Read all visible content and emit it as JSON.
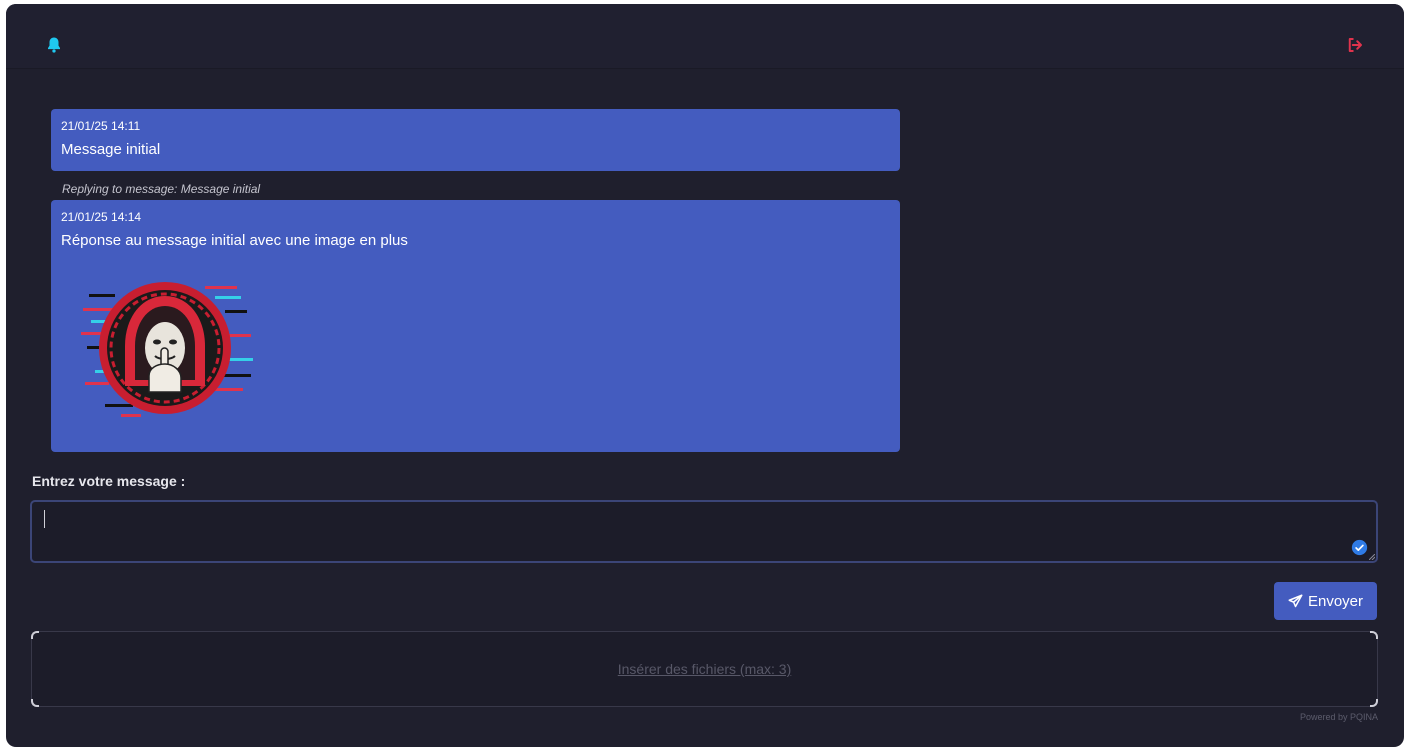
{
  "header": {
    "bell_icon": "bell-icon",
    "logout_icon": "logout-icon",
    "bell_color": "#1fc8f0",
    "logout_color": "#e0334d"
  },
  "messages": [
    {
      "timestamp": "21/01/25 14:11",
      "text": "Message initial"
    },
    {
      "reply_to": "Replying to message: Message initial",
      "timestamp": "21/01/25 14:14",
      "text": "Réponse au message initial avec une image en plus",
      "attachment_icon": "hooded-anonymous-mask-image"
    }
  ],
  "composer": {
    "label": "Entrez votre message :",
    "value": "",
    "send_label": "Envoyer",
    "send_icon": "paper-plane-icon",
    "check_icon": "check-circle-icon"
  },
  "uploader": {
    "prompt": "Insérer des fichiers (max: 3)",
    "credit": "Powered by PQINA"
  },
  "colors": {
    "background": "#1f1f2d",
    "message_bubble": "#445cbf",
    "accent": "#445cbf"
  }
}
